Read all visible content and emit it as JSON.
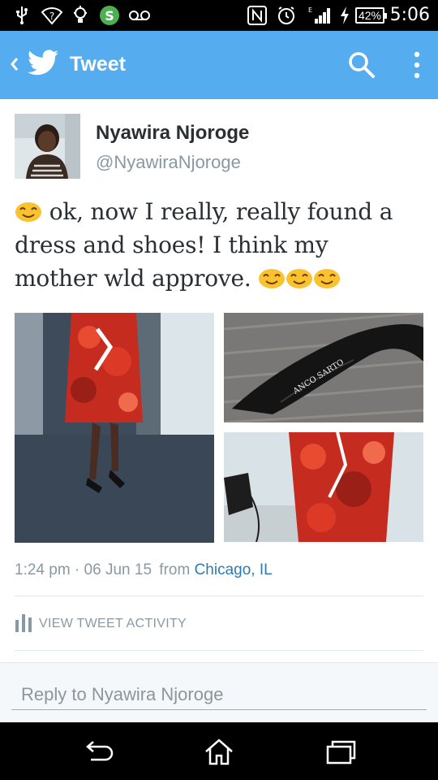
{
  "status_bar": {
    "battery": "42%",
    "time": "5:06",
    "icons": [
      "usb-icon",
      "wifi-question-icon",
      "bulb-icon",
      "dollar-app-icon",
      "voicemail-icon",
      "nfc-icon",
      "alarm-icon",
      "signal-icon",
      "charging-icon",
      "battery-icon"
    ]
  },
  "app_bar": {
    "title": "Tweet",
    "icons": [
      "back-chevron-icon",
      "twitter-bird-icon",
      "search-icon",
      "overflow-menu-icon"
    ]
  },
  "tweet": {
    "author_name": "Nyawira Njoroge",
    "author_handle": "@NyawiraNjoroge",
    "text_line1": " ok, now I really, really found a",
    "text_line2": "dress and shoes! I think my",
    "text_line3": "mother wld approve. ",
    "emoji": "smiling-face-emoji",
    "time": "1:24 pm",
    "date_sep": " · ",
    "date": "06 Jun 15",
    "from_label": "from",
    "location": "Chicago, IL",
    "media": [
      "photo-dress-hallway",
      "photo-black-shoe",
      "photo-dress-closeup"
    ],
    "shoe_brand_print": "ANCO SARTO"
  },
  "activity": {
    "label": "VIEW TWEET ACTIVITY",
    "icon": "bar-chart-icon"
  },
  "reply": {
    "placeholder": "Reply to Nyawira Njoroge"
  },
  "nav_bar": {
    "icons": [
      "back-nav-icon",
      "home-nav-icon",
      "recents-nav-icon"
    ]
  },
  "colors": {
    "twitter_blue": "#55acee",
    "link_blue": "#2b7bb9",
    "text_dark": "#292f33",
    "text_gray": "#8899a6"
  }
}
